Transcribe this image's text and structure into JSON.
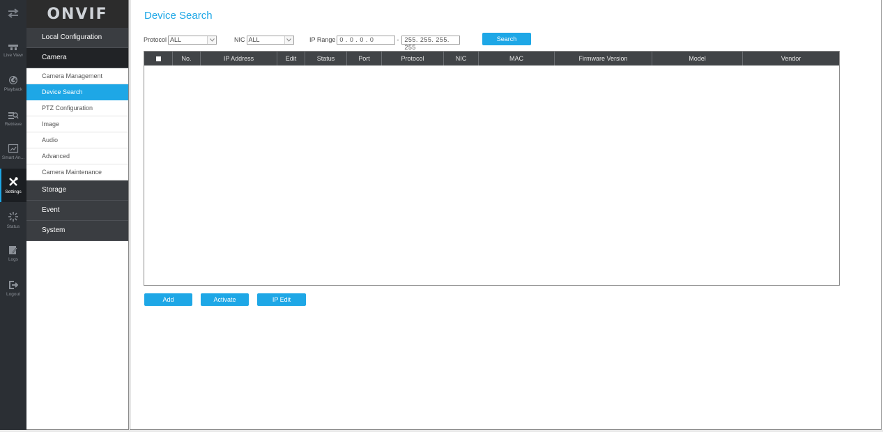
{
  "rail": {
    "top_icon": "swap-arrows-icon",
    "items": [
      {
        "label": "Live View",
        "icon": "live-view-icon"
      },
      {
        "label": "Playback",
        "icon": "playback-icon"
      },
      {
        "label": "Retrieve",
        "icon": "retrieve-icon"
      },
      {
        "label": "Smart An...",
        "icon": "smart-analytics-icon"
      },
      {
        "label": "Settings",
        "icon": "settings-tools-icon",
        "active": true
      },
      {
        "label": "Status",
        "icon": "status-spinner-icon"
      },
      {
        "label": "Logs",
        "icon": "logs-icon"
      },
      {
        "label": "Logout",
        "icon": "logout-icon"
      }
    ]
  },
  "sidebar": {
    "logo": "ONVIF",
    "sections": [
      {
        "label": "Local Configuration"
      },
      {
        "label": "Camera"
      }
    ],
    "camera_items": [
      {
        "label": "Camera Management"
      },
      {
        "label": "Device Search",
        "active": true
      },
      {
        "label": "PTZ Configuration"
      },
      {
        "label": "Image"
      },
      {
        "label": "Audio"
      },
      {
        "label": "Advanced"
      },
      {
        "label": "Camera Maintenance"
      }
    ],
    "lower_sections": [
      {
        "label": "Storage"
      },
      {
        "label": "Event"
      },
      {
        "label": "System"
      }
    ]
  },
  "page": {
    "title": "Device Search",
    "protocol_label": "Protocol",
    "protocol_value": "ALL",
    "nic_label": "NIC",
    "nic_value": "ALL",
    "ip_range_label": "IP Range",
    "ip_start": "0  .  0  .  0  .  0",
    "ip_separator": "-",
    "ip_end": "255. 255. 255. 255",
    "search_label": "Search"
  },
  "table": {
    "columns": [
      "No.",
      "IP Address",
      "Edit",
      "Status",
      "Port",
      "Protocol",
      "NIC",
      "MAC",
      "Firmware Version",
      "Model",
      "Vendor"
    ],
    "rows": []
  },
  "actions": {
    "add_label": "Add",
    "activate_label": "Activate",
    "ip_edit_label": "IP Edit"
  },
  "colors": {
    "accent": "#1ea7e6",
    "rail_bg": "#2b2f34",
    "table_header_bg": "#414447"
  }
}
